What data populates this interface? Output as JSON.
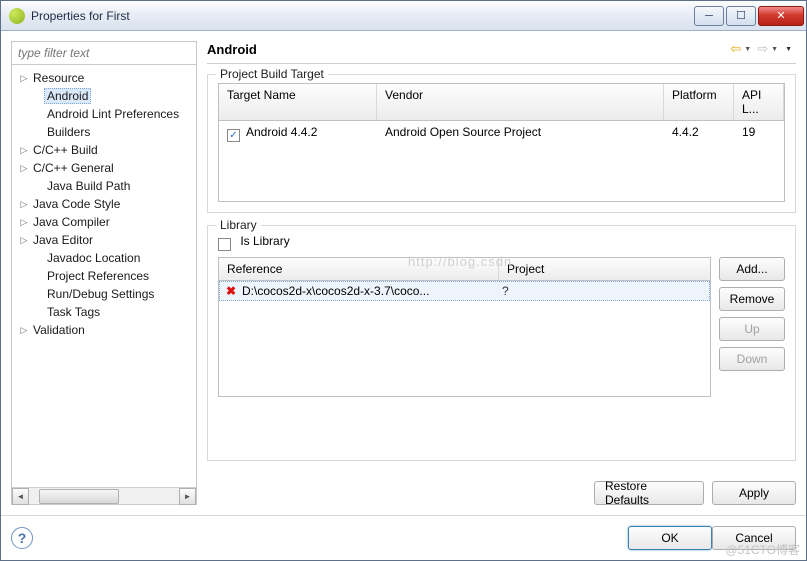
{
  "window": {
    "title": "Properties for First"
  },
  "filter": {
    "placeholder": "type filter text"
  },
  "tree": {
    "items": [
      {
        "label": "Resource",
        "expandable": true
      },
      {
        "label": "Android",
        "expandable": false,
        "selected": true
      },
      {
        "label": "Android Lint Preferences",
        "expandable": false
      },
      {
        "label": "Builders",
        "expandable": false
      },
      {
        "label": "C/C++ Build",
        "expandable": true
      },
      {
        "label": "C/C++ General",
        "expandable": true
      },
      {
        "label": "Java Build Path",
        "expandable": false
      },
      {
        "label": "Java Code Style",
        "expandable": true
      },
      {
        "label": "Java Compiler",
        "expandable": true
      },
      {
        "label": "Java Editor",
        "expandable": true
      },
      {
        "label": "Javadoc Location",
        "expandable": false
      },
      {
        "label": "Project References",
        "expandable": false
      },
      {
        "label": "Run/Debug Settings",
        "expandable": false
      },
      {
        "label": "Task Tags",
        "expandable": false
      },
      {
        "label": "Validation",
        "expandable": true
      }
    ]
  },
  "page": {
    "title": "Android"
  },
  "buildTarget": {
    "group": "Project Build Target",
    "headers": {
      "name": "Target Name",
      "vendor": "Vendor",
      "platform": "Platform",
      "api": "API L..."
    },
    "row": {
      "checked": true,
      "name": "Android 4.4.2",
      "vendor": "Android Open Source Project",
      "platform": "4.4.2",
      "api": "19"
    }
  },
  "library": {
    "group": "Library",
    "isLibraryLabel": "Is Library",
    "isLibraryChecked": false,
    "headers": {
      "ref": "Reference",
      "proj": "Project"
    },
    "row": {
      "ref": "D:\\cocos2d-x\\cocos2d-x-3.7\\coco...",
      "proj": "?"
    },
    "buttons": {
      "add": "Add...",
      "remove": "Remove",
      "up": "Up",
      "down": "Down"
    }
  },
  "footer": {
    "restore": "Restore Defaults",
    "apply": "Apply",
    "ok": "OK",
    "cancel": "Cancel"
  },
  "watermarks": {
    "blog": "http://blog.csdn",
    "corner": "@51CTO博客"
  }
}
